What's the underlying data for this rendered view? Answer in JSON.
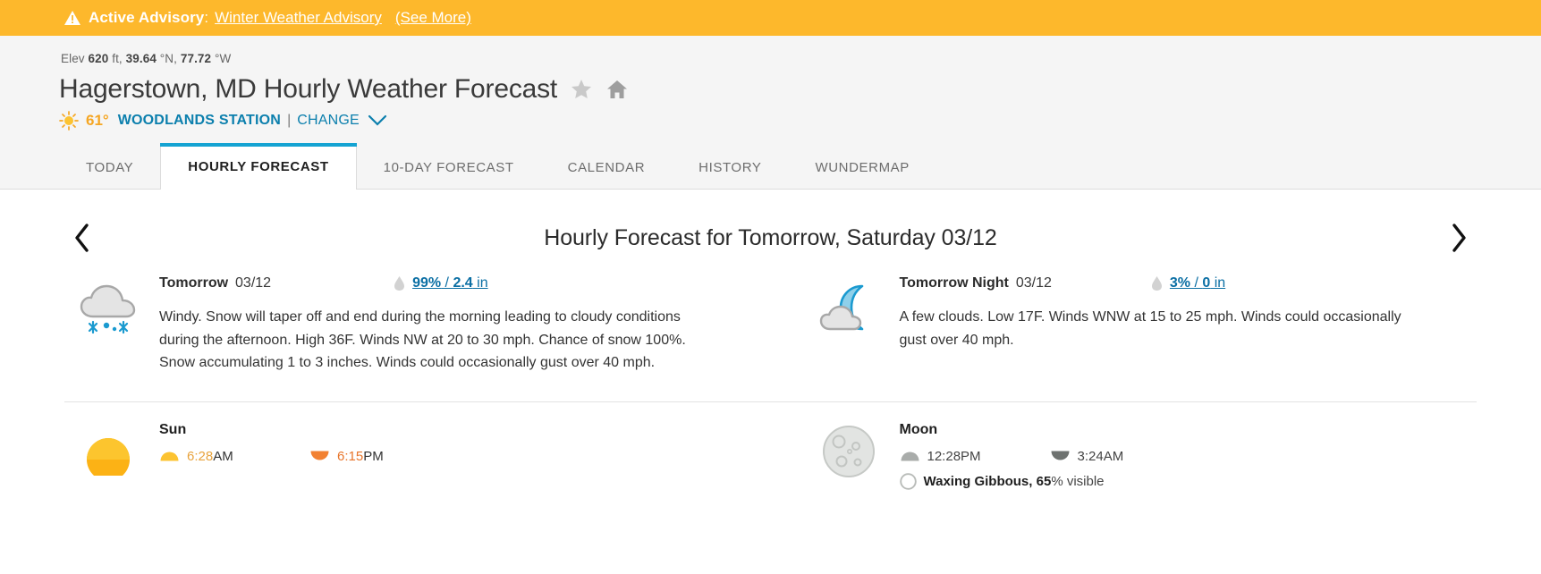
{
  "advisory": {
    "icon": "warning-triangle-icon",
    "label": "Active Advisory",
    "colon": ":",
    "link": "Winter Weather Advisory",
    "see_more": "(See More)",
    "background": "#fdb82c"
  },
  "header": {
    "elev_prefix": "Elev",
    "elev_value": "620",
    "elev_unit": "ft,",
    "lat_value": "39.64",
    "lat_unit": "°N,",
    "lon_value": "77.72",
    "lon_unit": "°W",
    "title": "Hagerstown, MD Hourly Weather Forecast",
    "star_icon": "star-icon",
    "home_icon": "home-icon",
    "current_temp": "61°",
    "station": "WOODLANDS STATION",
    "separator": "|",
    "change": "CHANGE",
    "chevron": "chevron-down-icon",
    "accent": "#0b7fad"
  },
  "tabs": [
    {
      "label": "TODAY",
      "active": false
    },
    {
      "label": "HOURLY FORECAST",
      "active": true
    },
    {
      "label": "10-DAY FORECAST",
      "active": false
    },
    {
      "label": "CALENDAR",
      "active": false
    },
    {
      "label": "HISTORY",
      "active": false
    },
    {
      "label": "WUNDERMAP",
      "active": false
    }
  ],
  "forecast": {
    "prev_icon": "chevron-left-icon",
    "next_icon": "chevron-right-icon",
    "title": "Hourly Forecast for Tomorrow, Saturday 03/12",
    "day": {
      "icon": "snow-cloud-icon",
      "period": "Tomorrow",
      "date": "03/12",
      "precip_icon": "raindrop-icon",
      "precip_chance": "99%",
      "precip_sep": " / ",
      "precip_amount": "2.4",
      "precip_unit": " in",
      "description": "Windy. Snow will taper off and end during the morning leading to cloudy conditions during the afternoon. High 36F. Winds NW at 20 to 30 mph. Chance of snow 100%. Snow accumulating 1 to 3 inches. Winds could occasionally gust over 40 mph."
    },
    "night": {
      "icon": "moon-cloud-icon",
      "period": "Tomorrow  Night",
      "date": "03/12",
      "precip_icon": "raindrop-icon",
      "precip_chance": "3%",
      "precip_sep": " / ",
      "precip_amount": "0",
      "precip_unit": " in",
      "description": "A few clouds. Low 17F. Winds WNW at 15 to 25 mph. Winds could occasionally gust over 40 mph."
    }
  },
  "astro": {
    "sun": {
      "icon": "sun-icon",
      "title": "Sun",
      "rise_icon": "sunrise-icon",
      "rise_time": "6:28",
      "rise_unit": "AM",
      "set_icon": "sunset-icon",
      "set_time": "6:15",
      "set_unit": "PM"
    },
    "moon": {
      "icon": "moon-icon",
      "title": "Moon",
      "rise_icon": "moonrise-icon",
      "rise_time": "12:28PM",
      "set_icon": "moonset-icon",
      "set_time": "3:24AM",
      "phase_icon": "moon-phase-icon",
      "phase_name": "Waxing Gibbous,",
      "phase_pct": "65",
      "phase_pct_suffix": "% visible"
    }
  }
}
